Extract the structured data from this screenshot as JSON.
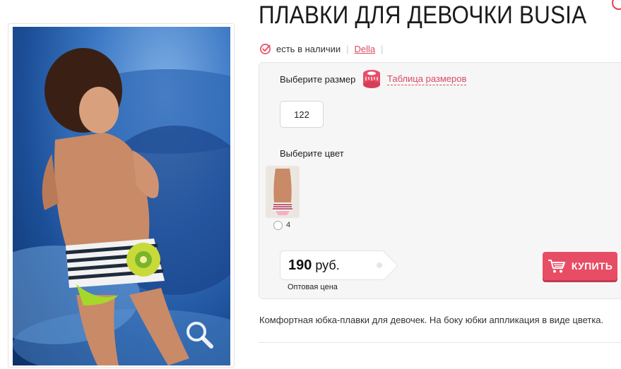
{
  "product": {
    "title": "ПЛАВКИ ДЛЯ ДЕВОЧКИ BUSIA",
    "availability": "есть в наличии",
    "brand": "Della",
    "description": "Комфортная юбка-плавки для девочек. На боку юбки аппликация в виде цветка."
  },
  "options": {
    "size_label": "Выберите размер",
    "size_table_label": "Таблица размеров",
    "sizes": [
      "122"
    ],
    "color_label": "Выберите цвет",
    "colors": [
      {
        "number": "4"
      }
    ]
  },
  "price": {
    "value": "190",
    "currency": "руб.",
    "note": "Оптовая цена"
  },
  "actions": {
    "buy_label": "КУПИТЬ"
  },
  "icons": {
    "availability": "check-circle-icon",
    "size_table": "measuring-tape-icon",
    "zoom": "magnifier-icon",
    "buy": "cart-icon"
  },
  "colors": {
    "accent": "#e84d66",
    "link": "#d94a63",
    "panel_bg": "#f6f6f6"
  }
}
